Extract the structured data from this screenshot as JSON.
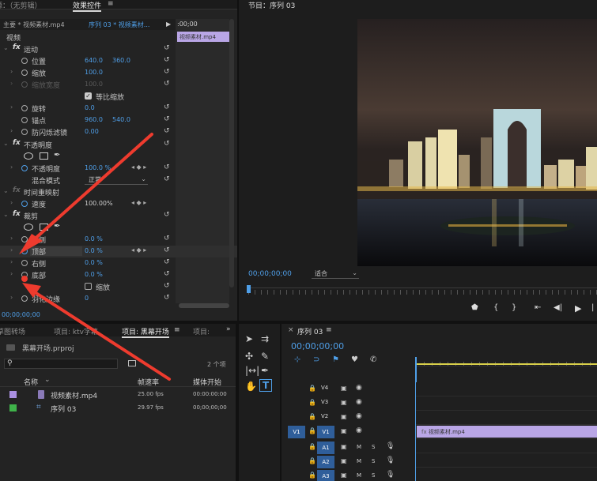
{
  "top_left_tabs": {
    "source": "源：（无剪辑）",
    "effect_controls": "效果控件",
    "menu_icon": "≡"
  },
  "effect_controls": {
    "master_label": "主要 * 视频素材.mp4",
    "sequence_label": "序列 03 * 视频素材...",
    "time_ruler_start": ":00;00",
    "clip_chip": "视频素材.mp4",
    "section_video": "视频",
    "motion": "运动",
    "position": "位置",
    "position_x": "640.0",
    "position_y": "360.0",
    "scale": "缩放",
    "scale_val": "100.0",
    "scale_width": "缩放宽度",
    "scale_width_val": "100.0",
    "uniform_scale": "等比缩放",
    "rotation": "旋转",
    "rotation_val": "0.0",
    "anchor": "锚点",
    "anchor_x": "960.0",
    "anchor_y": "540.0",
    "antiflicker": "防闪烁滤镜",
    "antiflicker_val": "0.00",
    "opacity_section": "不透明度",
    "opacity": "不透明度",
    "opacity_val": "100.0 %",
    "blend_mode": "混合模式",
    "blend_mode_val": "正常",
    "time_remap": "时间重映射",
    "speed": "速度",
    "speed_val": "100.00%",
    "crop": "裁剪",
    "left": "左侧",
    "left_val": "0.0 %",
    "top": "顶部",
    "top_val": "0.0 %",
    "right": "右侧",
    "right_val": "0.0 %",
    "bottom": "底部",
    "bottom_val": "0.0 %",
    "zoom": "缩放",
    "feather": "羽化边缘",
    "feather_val": "0",
    "bottom_timecode": "00;00;00;00"
  },
  "program": {
    "title": "节目：序列 03",
    "menu_icon": "≡",
    "timecode": "00;00;00;00",
    "fit": "适合"
  },
  "project_tabs": {
    "t1": "草图转场",
    "t2": "项目: ktv字幕",
    "t3": "项目: 黑幕开场",
    "t4": "项目:",
    "more": "»"
  },
  "project": {
    "filename": "黑幕开场.prproj",
    "items_count": "2 个项",
    "col_name": "名称",
    "col_fps": "帧速率",
    "col_start": "媒体开始",
    "items": [
      {
        "name": "视频素材.mp4",
        "fps": "25.00 fps",
        "start": "00:00:00:00",
        "color": "#a98fe0"
      },
      {
        "name": "序列 03",
        "fps": "29.97 fps",
        "start": "00;00;00;00",
        "color": "#3fb34a"
      }
    ]
  },
  "timeline": {
    "title": "序列 03",
    "menu_icon": "≡",
    "timecode": "00;00;00;00",
    "clip_label": "视频素材.mp4",
    "tracks": [
      "V4",
      "V3",
      "V2",
      "V1",
      "A1",
      "A2",
      "A3"
    ],
    "source_v1": "V1",
    "m": "M",
    "s": "S"
  },
  "colors": {
    "accent_blue": "#4f9fe8",
    "clip_purple": "#b9a6e6",
    "arrow_red": "#ee3b2e",
    "track_blue": "#2f5e9a"
  }
}
